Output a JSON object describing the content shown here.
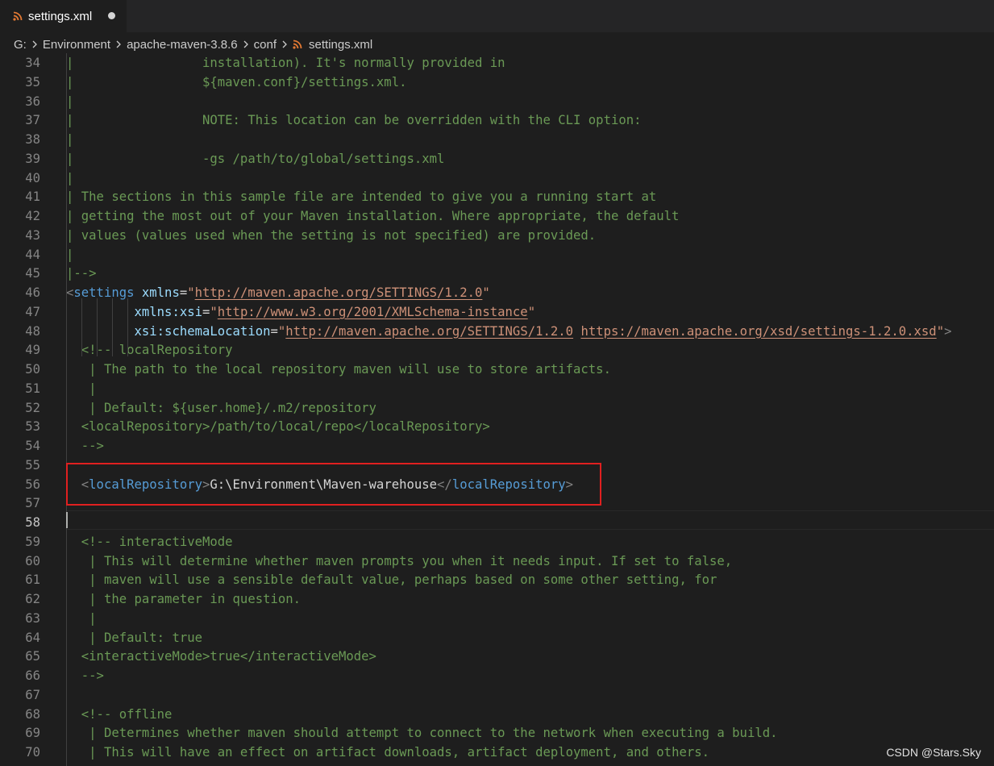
{
  "window": {
    "tab": {
      "title": "settings.xml",
      "icon": "rss-icon",
      "modified": true
    },
    "breadcrumb": [
      "G:",
      "Environment",
      "apache-maven-3.8.6",
      "conf",
      "settings.xml"
    ]
  },
  "editor": {
    "current_line": 58,
    "lines": [
      {
        "n": "34",
        "tokens": [
          {
            "c": "comment",
            "t": "|                 installation). It's normally provided in"
          }
        ]
      },
      {
        "n": "35",
        "tokens": [
          {
            "c": "comment",
            "t": "|                 ${maven.conf}/settings.xml."
          }
        ]
      },
      {
        "n": "36",
        "tokens": [
          {
            "c": "comment",
            "t": "|"
          }
        ]
      },
      {
        "n": "37",
        "tokens": [
          {
            "c": "comment",
            "t": "|                 NOTE: This location can be overridden with the CLI option:"
          }
        ]
      },
      {
        "n": "38",
        "tokens": [
          {
            "c": "comment",
            "t": "|"
          }
        ]
      },
      {
        "n": "39",
        "tokens": [
          {
            "c": "comment",
            "t": "|                 -gs /path/to/global/settings.xml"
          }
        ]
      },
      {
        "n": "40",
        "tokens": [
          {
            "c": "comment",
            "t": "|"
          }
        ]
      },
      {
        "n": "41",
        "tokens": [
          {
            "c": "comment",
            "t": "| The sections in this sample file are intended to give you a running start at"
          }
        ]
      },
      {
        "n": "42",
        "tokens": [
          {
            "c": "comment",
            "t": "| getting the most out of your Maven installation. Where appropriate, the default"
          }
        ]
      },
      {
        "n": "43",
        "tokens": [
          {
            "c": "comment",
            "t": "| values (values used when the setting is not specified) are provided."
          }
        ]
      },
      {
        "n": "44",
        "tokens": [
          {
            "c": "comment",
            "t": "|"
          }
        ]
      },
      {
        "n": "45",
        "tokens": [
          {
            "c": "comment",
            "t": "|-->"
          }
        ]
      },
      {
        "n": "46",
        "tokens": [
          {
            "c": "tagb",
            "t": "<"
          },
          {
            "c": "tag",
            "t": "settings"
          },
          {
            "c": "text",
            "t": " "
          },
          {
            "c": "attr",
            "t": "xmlns"
          },
          {
            "c": "text",
            "t": "="
          },
          {
            "c": "str",
            "t": "\""
          },
          {
            "c": "url",
            "t": "http://maven.apache.org/SETTINGS/1.2.0"
          },
          {
            "c": "str",
            "t": "\""
          }
        ]
      },
      {
        "n": "47",
        "tokens": [
          {
            "c": "text",
            "t": "         "
          },
          {
            "c": "attr",
            "t": "xmlns:xsi"
          },
          {
            "c": "text",
            "t": "="
          },
          {
            "c": "str",
            "t": "\""
          },
          {
            "c": "url",
            "t": "http://www.w3.org/2001/XMLSchema-instance"
          },
          {
            "c": "str",
            "t": "\""
          }
        ]
      },
      {
        "n": "48",
        "tokens": [
          {
            "c": "text",
            "t": "         "
          },
          {
            "c": "attr",
            "t": "xsi:schemaLocation"
          },
          {
            "c": "text",
            "t": "="
          },
          {
            "c": "str",
            "t": "\""
          },
          {
            "c": "url",
            "t": "http://maven.apache.org/SETTINGS/1.2.0"
          },
          {
            "c": "str",
            "t": " "
          },
          {
            "c": "url",
            "t": "https://maven.apache.org/xsd/settings-1.2.0.xsd"
          },
          {
            "c": "str",
            "t": "\""
          },
          {
            "c": "tagb",
            "t": ">"
          }
        ]
      },
      {
        "n": "49",
        "tokens": [
          {
            "c": "text",
            "t": "  "
          },
          {
            "c": "comment",
            "t": "<!-- localRepository"
          }
        ]
      },
      {
        "n": "50",
        "tokens": [
          {
            "c": "text",
            "t": "   "
          },
          {
            "c": "comment",
            "t": "| The path to the local repository maven will use to store artifacts."
          }
        ]
      },
      {
        "n": "51",
        "tokens": [
          {
            "c": "text",
            "t": "   "
          },
          {
            "c": "comment",
            "t": "|"
          }
        ]
      },
      {
        "n": "52",
        "tokens": [
          {
            "c": "text",
            "t": "   "
          },
          {
            "c": "comment",
            "t": "| Default: ${user.home}/.m2/repository"
          }
        ]
      },
      {
        "n": "53",
        "tokens": [
          {
            "c": "text",
            "t": "  "
          },
          {
            "c": "comment",
            "t": "<localRepository>/path/to/local/repo</localRepository>"
          }
        ]
      },
      {
        "n": "54",
        "tokens": [
          {
            "c": "text",
            "t": "  "
          },
          {
            "c": "comment",
            "t": "-->"
          }
        ]
      },
      {
        "n": "55",
        "tokens": []
      },
      {
        "n": "56",
        "tokens": [
          {
            "c": "text",
            "t": "  "
          },
          {
            "c": "tagb",
            "t": "<"
          },
          {
            "c": "tag",
            "t": "localRepository"
          },
          {
            "c": "tagb",
            "t": ">"
          },
          {
            "c": "text",
            "t": "G:\\Environment\\Maven-warehouse"
          },
          {
            "c": "tagb",
            "t": "</"
          },
          {
            "c": "tag",
            "t": "localRepository"
          },
          {
            "c": "tagb",
            "t": ">"
          }
        ]
      },
      {
        "n": "57",
        "tokens": []
      },
      {
        "n": "58",
        "tokens": []
      },
      {
        "n": "59",
        "tokens": [
          {
            "c": "text",
            "t": "  "
          },
          {
            "c": "comment",
            "t": "<!-- interactiveMode"
          }
        ]
      },
      {
        "n": "60",
        "tokens": [
          {
            "c": "text",
            "t": "   "
          },
          {
            "c": "comment",
            "t": "| This will determine whether maven prompts you when it needs input. If set to false,"
          }
        ]
      },
      {
        "n": "61",
        "tokens": [
          {
            "c": "text",
            "t": "   "
          },
          {
            "c": "comment",
            "t": "| maven will use a sensible default value, perhaps based on some other setting, for"
          }
        ]
      },
      {
        "n": "62",
        "tokens": [
          {
            "c": "text",
            "t": "   "
          },
          {
            "c": "comment",
            "t": "| the parameter in question."
          }
        ]
      },
      {
        "n": "63",
        "tokens": [
          {
            "c": "text",
            "t": "   "
          },
          {
            "c": "comment",
            "t": "|"
          }
        ]
      },
      {
        "n": "64",
        "tokens": [
          {
            "c": "text",
            "t": "   "
          },
          {
            "c": "comment",
            "t": "| Default: true"
          }
        ]
      },
      {
        "n": "65",
        "tokens": [
          {
            "c": "text",
            "t": "  "
          },
          {
            "c": "comment",
            "t": "<interactiveMode>true</interactiveMode>"
          }
        ]
      },
      {
        "n": "66",
        "tokens": [
          {
            "c": "text",
            "t": "  "
          },
          {
            "c": "comment",
            "t": "-->"
          }
        ]
      },
      {
        "n": "67",
        "tokens": []
      },
      {
        "n": "68",
        "tokens": [
          {
            "c": "text",
            "t": "  "
          },
          {
            "c": "comment",
            "t": "<!-- offline"
          }
        ]
      },
      {
        "n": "69",
        "tokens": [
          {
            "c": "text",
            "t": "   "
          },
          {
            "c": "comment",
            "t": "| Determines whether maven should attempt to connect to the network when executing a build."
          }
        ]
      },
      {
        "n": "70",
        "tokens": [
          {
            "c": "text",
            "t": "   "
          },
          {
            "c": "comment",
            "t": "| This will have an effect on artifact downloads, artifact deployment, and others."
          }
        ]
      }
    ]
  },
  "watermark": "CSDN @Stars.Sky",
  "colors": {
    "background": "#1e1e1e",
    "comment": "#6a9955",
    "tag": "#569cd6",
    "attribute": "#9cdcfe",
    "string": "#ce9178",
    "annotation_box": "#e02020"
  }
}
